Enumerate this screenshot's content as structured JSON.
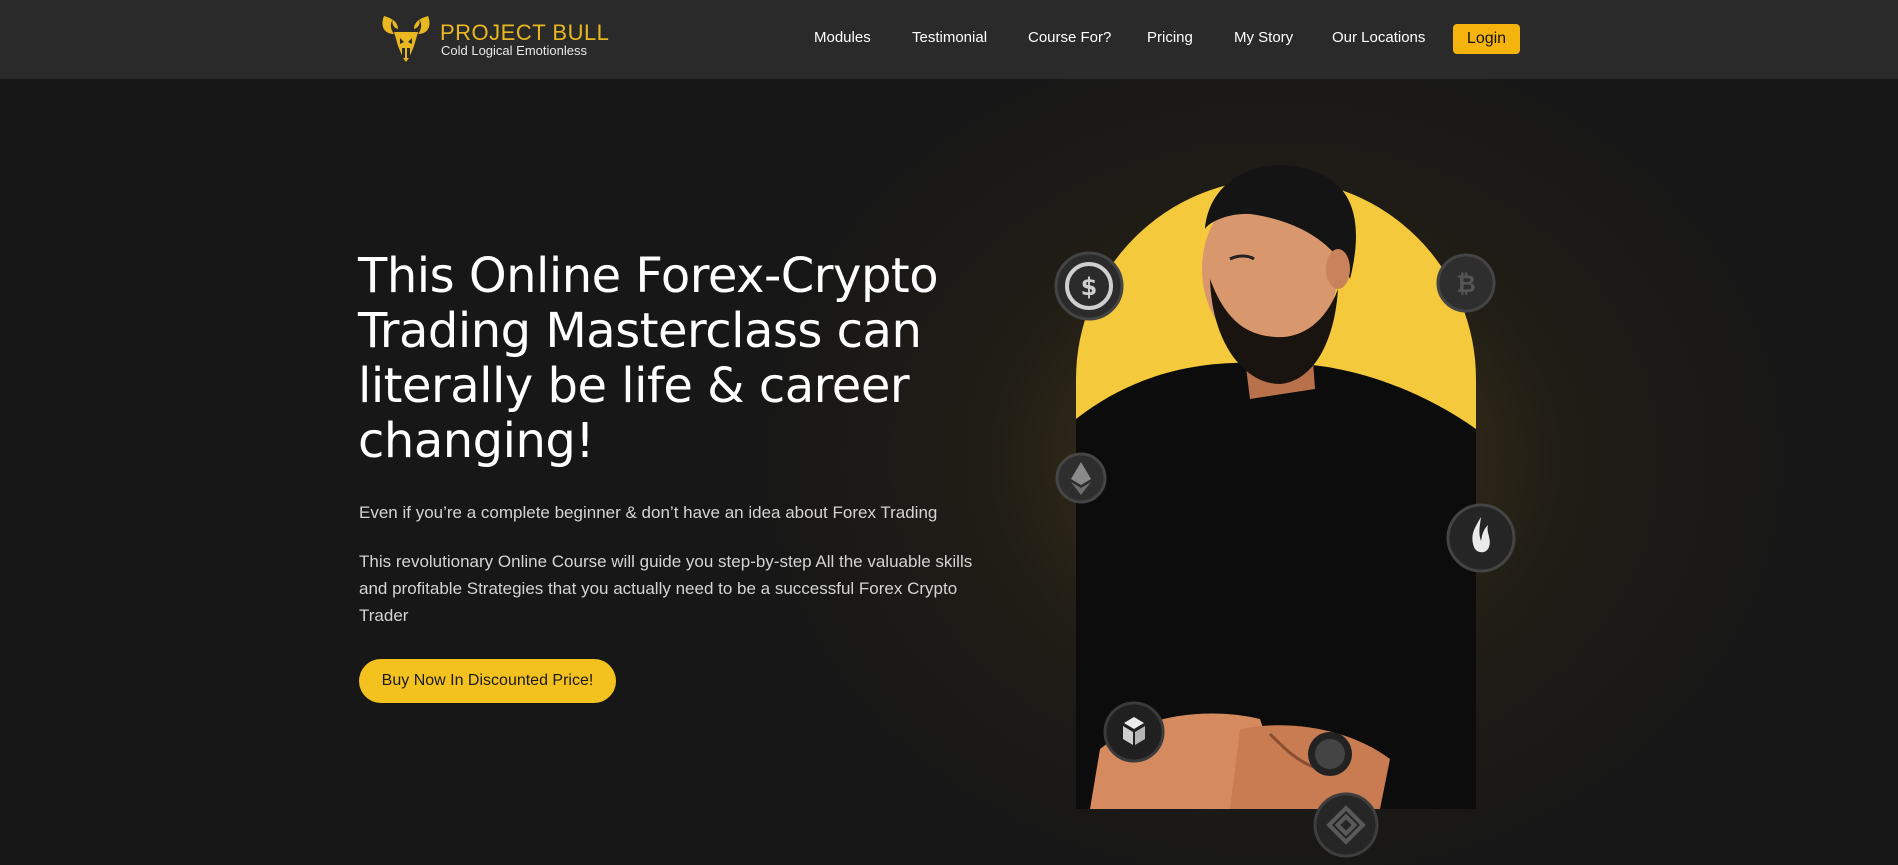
{
  "brand": {
    "name": "PROJECT BULL",
    "tagline": "Cold Logical Emotionless"
  },
  "nav": {
    "links": [
      "Modules",
      "Testimonial",
      "Course For?",
      "Pricing",
      "My Story",
      "Our Locations"
    ],
    "login_label": "Login"
  },
  "hero": {
    "headline_lines": [
      "This Online Forex-Crypto",
      "Trading Masterclass can",
      "literally be life & career",
      "changing!"
    ],
    "subtitle": "Even if you’re a complete beginner & don’t have an idea about Forex Trading",
    "description": "This revolutionary Online Course will guide you step-by-step All the valuable skills and profitable Strategies that you actually need to be a successful Forex Crypto Trader",
    "cta_label": "Buy Now In Discounted Price!"
  },
  "colors": {
    "navbar_bg": "#2a2a2a",
    "page_bg": "#171717",
    "accent": "#f4c21f",
    "login_bg": "#f5b40d"
  },
  "icons": [
    "bull-logo-icon",
    "usdc-coin-icon",
    "bitcoin-coin-icon",
    "ethereum-coin-icon",
    "flame-coin-icon",
    "bancor-coin-icon",
    "binance-coin-icon"
  ]
}
